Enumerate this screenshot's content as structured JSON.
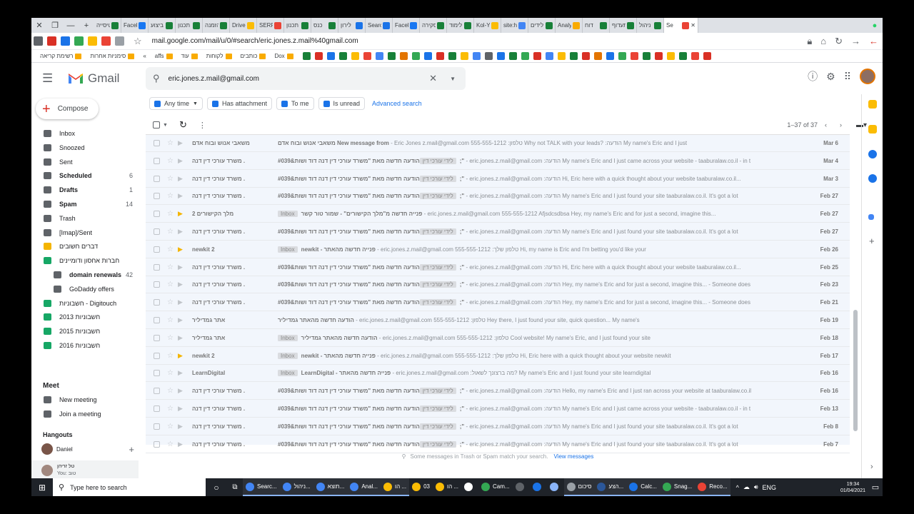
{
  "browser": {
    "tabs": [
      "כרטיסייה",
      "Faceb",
      "ביצוע",
      "תכנון",
      "הזמנה",
      "Drive",
      "SERP",
      "תכנון",
      "כנס",
      "לירון",
      "Search",
      "Faceb",
      "סקירה",
      "לימוד",
      "Kol-Yo",
      "site:h",
      "לידים",
      "Analyt",
      "דוח",
      "תעדוף",
      "ניהול",
      "Se"
    ],
    "url": "mail.google.com/mail/u/0/#search/eric.jones.z.mail%40gmail.com",
    "bookmarks": [
      "רשימת קריאה",
      "סימניות אחרות",
      "affs",
      "עוד",
      "לקוחות",
      "כותבים",
      "Dox"
    ]
  },
  "gmail": {
    "app_name": "Gmail",
    "search_query": "eric.jones.z.mail@gmail.com",
    "compose": "Compose",
    "nav": [
      {
        "label": "Inbox",
        "count": ""
      },
      {
        "label": "Snoozed",
        "count": ""
      },
      {
        "label": "Sent",
        "count": ""
      },
      {
        "label": "Scheduled",
        "count": "6"
      },
      {
        "label": "Drafts",
        "count": "1"
      },
      {
        "label": "Spam",
        "count": "14"
      },
      {
        "label": "Trash",
        "count": ""
      },
      {
        "label": "[Imap]/Sent",
        "count": ""
      },
      {
        "label": "דברים חשובים",
        "count": ""
      },
      {
        "label": "חברות אחסון ודומיינים",
        "count": ""
      },
      {
        "label": "domain renewals",
        "count": "42"
      },
      {
        "label": "GoDaddy offers",
        "count": ""
      },
      {
        "label": "חשבוניות - Digitouch",
        "count": ""
      },
      {
        "label": "חשבוניות 2013",
        "count": ""
      },
      {
        "label": "חשבוניות 2015",
        "count": ""
      },
      {
        "label": "חשבוניות 2016",
        "count": ""
      }
    ],
    "meet": {
      "title": "Meet",
      "new_meeting": "New meeting",
      "join": "Join a meeting"
    },
    "hangouts": {
      "title": "Hangouts",
      "user": "Daniel",
      "contact": "טל זריהן",
      "contact_msg": "You: טוב"
    },
    "filters": [
      "Any time",
      "Has attachment",
      "To me",
      "Is unread"
    ],
    "advanced": "Advanced search",
    "pager": "1–37 of 37",
    "emails": [
      {
        "from": "משאבי אנוש ובוח אדם",
        "label": "",
        "subject": "משאבי אנוש ובוח אדם  New message from",
        "snippet": " - Eric Jones z.mail@gmail.com 555-555-1212 :טלפון Why not TALK with your leads? :הודעה My name's Eric and I just",
        "date": "Mar 6"
      },
      {
        "from": "משרד עורכי דין דנה .",
        "label": "לידי עורכי דין",
        "subject": "הודעה חדשה מאת \"משרד עורכי דין דנה דוד ושות&#039;\"",
        "snippet": " - eric.jones.z.mail@gmail.com :הודעה My name's Eric and I just came across your website - taaburalaw.co.il - in t",
        "date": "Mar 4"
      },
      {
        "from": "משרד עורכי דין דנה .",
        "label": "לידי עורכי דין",
        "subject": "הודעה חדשה מאת \"משרד עורכי דין דנה דוד ושות&#039;\"",
        "snippet": " - eric.jones.z.mail@gmail.com :הודעה Hi, Eric here with a quick thought about your website taaburalaw.co.il...",
        "date": "Mar 3"
      },
      {
        "from": "משרד עורכי דין דנה .",
        "label": "לידי עורכי דין",
        "subject": "הודעה חדשה מאת \"משרד עורכי דין דנה דוד ושות&#039;\"",
        "snippet": " - eric.jones.z.mail@gmail.com :הודעה My name's Eric and I just found your site taaburalaw.co.il. It's got a lot",
        "date": "Feb 27"
      },
      {
        "from": "מלך הקישורים 2",
        "label": "Inbox",
        "subject": "פנייה חדשה מ\"מלך הקישורים\" - שמור טור קשר",
        "snippet": " - eric.jones.z.mail@gmail.com 555-555-1212 Afjsdcsdbsa Hey, my name's Eric and for just a second, imagine this...",
        "date": "Feb 27"
      },
      {
        "from": "משרד עורכי דין דנה .",
        "label": "לידי עורכי דין",
        "subject": "הודעה חדשה מאת \"משרד עורכי דין דנה דוד ושות&#039;\"",
        "snippet": " - eric.jones.z.mail@gmail.com :הודעה My name's Eric and I just found your site taaburalaw.co.il. It's got a lot",
        "date": "Feb 27"
      },
      {
        "from": "newkit 2",
        "label": "Inbox",
        "subject": "newkit - פנייה חדשה מהאתר",
        "snippet": " - eric.jones.z.mail@gmail.com 555-555-1212 :טלפון שלך Hi, my name is Eric and I'm betting you'd like your",
        "date": "Feb 26"
      },
      {
        "from": "משרד עורכי דין דנה .",
        "label": "לידי עורכי דין",
        "subject": "הודעה חדשה מאת \"משרד עורכי דין דנה דוד ושות&#039;\"",
        "snippet": " - eric.jones.z.mail@gmail.com :הודעה Hi, Eric here with a quick thought about your website taaburalaw.co.il...",
        "date": "Feb 25"
      },
      {
        "from": "משרד עורכי דין דנה .",
        "label": "לידי עורכי דין",
        "subject": "הודעה חדשה מאת \"משרד עורכי דין דנה דוד ושות&#039;\"",
        "snippet": " - eric.jones.z.mail@gmail.com :הודעה Hey, my name's Eric and for just a second, imagine this... - Someone does",
        "date": "Feb 23"
      },
      {
        "from": "משרד עורכי דין דנה .",
        "label": "לידי עורכי דין",
        "subject": "הודעה חדשה מאת \"משרד עורכי דין דנה דוד ושות&#039;\"",
        "snippet": " - eric.jones.z.mail@gmail.com :הודעה Hey, my name's Eric and for just a second, imagine this... - Someone does",
        "date": "Feb 21"
      },
      {
        "from": "אתר גמדיליר",
        "label": "",
        "subject": "הודעה חדשה מהאתר גמדיליר",
        "snippet": " - eric.jones.z.mail@gmail.com 555-555-1212 :טלפון Hey there, I just found your site, quick question... My name's",
        "date": "Feb 19"
      },
      {
        "from": "אתר גמדיליר",
        "label": "Inbox",
        "subject": "הודעה חדשה מהאתר גמדיליר",
        "snippet": " - eric.jones.z.mail@gmail.com 555-555-1212 :טלפון Cool website! My name's Eric, and I just found your site",
        "date": "Feb 18"
      },
      {
        "from": "newkit 2",
        "label": "Inbox",
        "subject": "newkit - פנייה חדשה מהאתר",
        "snippet": " - eric.jones.z.mail@gmail.com 555-555-1212 :טלפון שלך Hi, Eric here with a quick thought about your website newkit",
        "date": "Feb 17"
      },
      {
        "from": "LearnDigital",
        "label": "Inbox",
        "subject": "LearnDigital - פנייה חדשה מהאתר",
        "snippet": " - eric.jones.z.mail@gmail.com :מה ברצונך לשאול? My name's Eric and I just found your site learndigital",
        "date": "Feb 16"
      },
      {
        "from": "משרד עורכי דין דנה .",
        "label": "לידי עורכי דין",
        "subject": "הודעה חדשה מאת \"משרד עורכי דין דנה דוד ושות&#039;\"",
        "snippet": " - eric.jones.z.mail@gmail.com :הודעה Hello, my name's Eric and I just ran across your website at taaburalaw.co.il",
        "date": "Feb 16"
      },
      {
        "from": "משרד עורכי דין דנה .",
        "label": "לידי עורכי דין",
        "subject": "הודעה חדשה מאת \"משרד עורכי דין דנה דוד ושות&#039;\"",
        "snippet": " - eric.jones.z.mail@gmail.com :הודעה My name's Eric and I just came across your website - taaburalaw.co.il - in t",
        "date": "Feb 13"
      },
      {
        "from": "משרד עורכי דין דנה .",
        "label": "לידי עורכי דין",
        "subject": "הודעה חדשה מאת \"משרד עורכי דין דנה דוד ושות&#039;\"",
        "snippet": " - eric.jones.z.mail@gmail.com :הודעה My name's Eric and I just found your site taaburalaw.co.il. It's got a lot",
        "date": "Feb 8"
      },
      {
        "from": "משרד עורכי דין דנה .",
        "label": "לידי עורכי דין",
        "subject": "הודעה חדשה מאת \"משרד עורכי דין דנה דוד ושות&#039;\"",
        "snippet": " - eric.jones.z.mail@gmail.com :הודעה My name's Eric and I just found your site taaburalaw.co.il. It's got a lot",
        "date": "Feb 7"
      }
    ],
    "footer": "Some messages in Trash or Spam match your search.",
    "footer_link": "View messages"
  },
  "taskbar": {
    "search_placeholder": "Type here to search",
    "apps": [
      "Searc...",
      "ניהול...",
      "תוצא...",
      "Anal...",
      "הו ...",
      "03",
      "הו ...",
      "",
      "Cam...",
      "",
      "",
      "",
      "סיכום",
      "הצע...",
      "Calc...",
      "Snag...",
      "Reco..."
    ],
    "lang": "ENG",
    "time": "19:34",
    "date": "01/04/2021"
  }
}
